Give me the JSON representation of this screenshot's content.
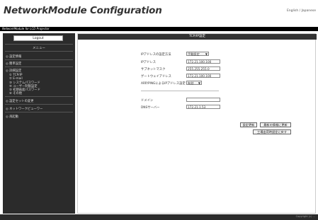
{
  "header": {
    "title": "NetworkModule Configuration",
    "language_link": "English / Japanese",
    "subtitle": "NetworkModule for LCD Projector"
  },
  "sidebar": {
    "logout_label": "Logout",
    "menu_title": "メニュー",
    "items": [
      {
        "label": "◎ 設定情報"
      },
      {
        "label": "◎ 簡単設定"
      },
      {
        "label": "◎ 詳細設定"
      }
    ],
    "subitems": [
      {
        "label": "① TCP/IP"
      },
      {
        "label": "② E-mail"
      },
      {
        "label": "③ システムパスワード"
      },
      {
        "label": "④ ユーザー制限設定"
      },
      {
        "label": "⑤ 初期画面パスワード"
      },
      {
        "label": "⑥ その他"
      }
    ],
    "items2": [
      {
        "label": "◎ 設定セットの変更"
      },
      {
        "label": "◎ ネットワークビューワー"
      },
      {
        "label": "◎ 再起動"
      }
    ]
  },
  "main": {
    "section_title": "TCP/IP設定",
    "fields": {
      "ip_method_label": "IPアドレスの設定方法",
      "ip_method_value": "手動設定",
      "ip_label": "IPアドレス",
      "ip_value": "172.21.100.100",
      "subnet_label": "サブネットマスク",
      "subnet_value": "255.255.255.0",
      "gateway_label": "ゲートウェイアドレス",
      "gateway_value": "172.21.100.100",
      "arp_label": "ARP/PINGによるIPアドレス設定",
      "arp_value": "有効",
      "domain_label": "ドメイン",
      "domain_value": "",
      "dns_label": "DNSサーバー",
      "dns_value": "172.21.1.53"
    },
    "buttons": {
      "update": "設定更新",
      "restore": "最新の情報に更新",
      "factory": "工場出荷時設定に戻す"
    }
  },
  "footer": {
    "copyright": "Copyright (c) ..."
  }
}
